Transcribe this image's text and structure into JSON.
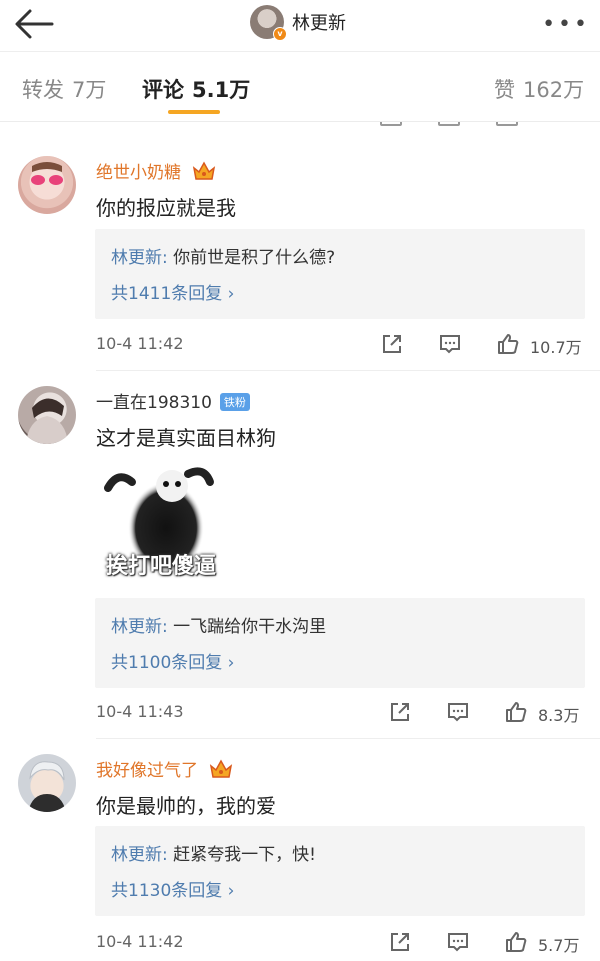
{
  "header": {
    "title": "林更新",
    "more_label": "•••"
  },
  "tabs": [
    {
      "label": "转发",
      "count": "7万"
    },
    {
      "label": "评论",
      "count": "5.1万"
    },
    {
      "label": "赞",
      "count": "162万"
    }
  ],
  "comments": [
    {
      "username": "绝世小奶糖",
      "text": "你的报应就是我",
      "reply": {
        "author": "林更新:",
        "text": "你前世是积了什么德?",
        "count": "共1411条回复 ›"
      },
      "time": "10-4 11:42",
      "likes": "10.7万"
    },
    {
      "username": "一直在198310",
      "badge": "铁粉",
      "text": "这才是真实面目林狗",
      "sticker_caption": "挨打吧傻逼",
      "reply": {
        "author": "林更新:",
        "text": "一飞踹给你干水沟里",
        "count": "共1100条回复 ›"
      },
      "time": "10-4 11:43",
      "likes": "8.3万"
    },
    {
      "username": "我好像过气了",
      "text": "你是最帅的，我的爱",
      "reply": {
        "author": "林更新:",
        "text": "赶紧夸我一下，快!",
        "count": "共1130条回复 ›"
      },
      "time": "10-4 11:42",
      "likes": "5.7万"
    }
  ],
  "colors": {
    "accent": "#f5a623",
    "link": "#4f7cae",
    "vip_name": "#e0762a"
  },
  "icons": [
    "back-arrow-icon",
    "more-icon",
    "share-icon",
    "comment-icon",
    "like-icon",
    "crown-icon"
  ]
}
